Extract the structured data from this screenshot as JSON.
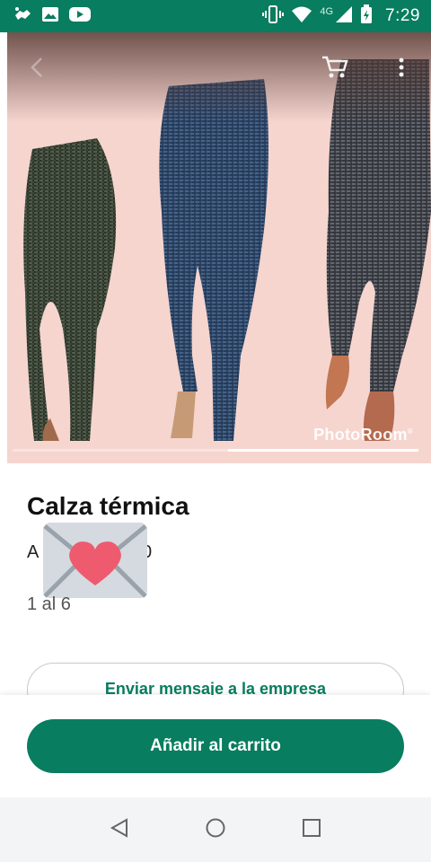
{
  "status_bar": {
    "time": "7:29",
    "network": "4G",
    "left_icons": [
      "hand-shake-icon",
      "image-icon",
      "youtube-icon"
    ],
    "right_icons": [
      "vibrate-icon",
      "wifi-icon",
      "signal-icon",
      "battery-charging-icon"
    ]
  },
  "toolbar": {
    "back_icon": "back-arrow-icon",
    "cart_icon": "cart-icon",
    "more_icon": "more-vert-icon"
  },
  "image": {
    "watermark": "PhotoRoom",
    "watermark_mark": "®",
    "carousel_progress_fraction": 0.47
  },
  "product": {
    "title": "Calza térmica",
    "price_start": "A",
    "price_end": "0",
    "sticker_icon": "love-letter-emoji",
    "stock": "1 al 6"
  },
  "actions": {
    "message_label": "Enviar mensaje a la empresa",
    "add_to_cart_label": "Añadir al carrito"
  },
  "nav": {
    "back_icon": "nav-back-icon",
    "home_icon": "nav-home-icon",
    "recents_icon": "nav-recents-icon"
  },
  "colors": {
    "brand": "#087d5f",
    "image_background": "#f6d5cf",
    "nav_background": "#f3f4f6"
  }
}
